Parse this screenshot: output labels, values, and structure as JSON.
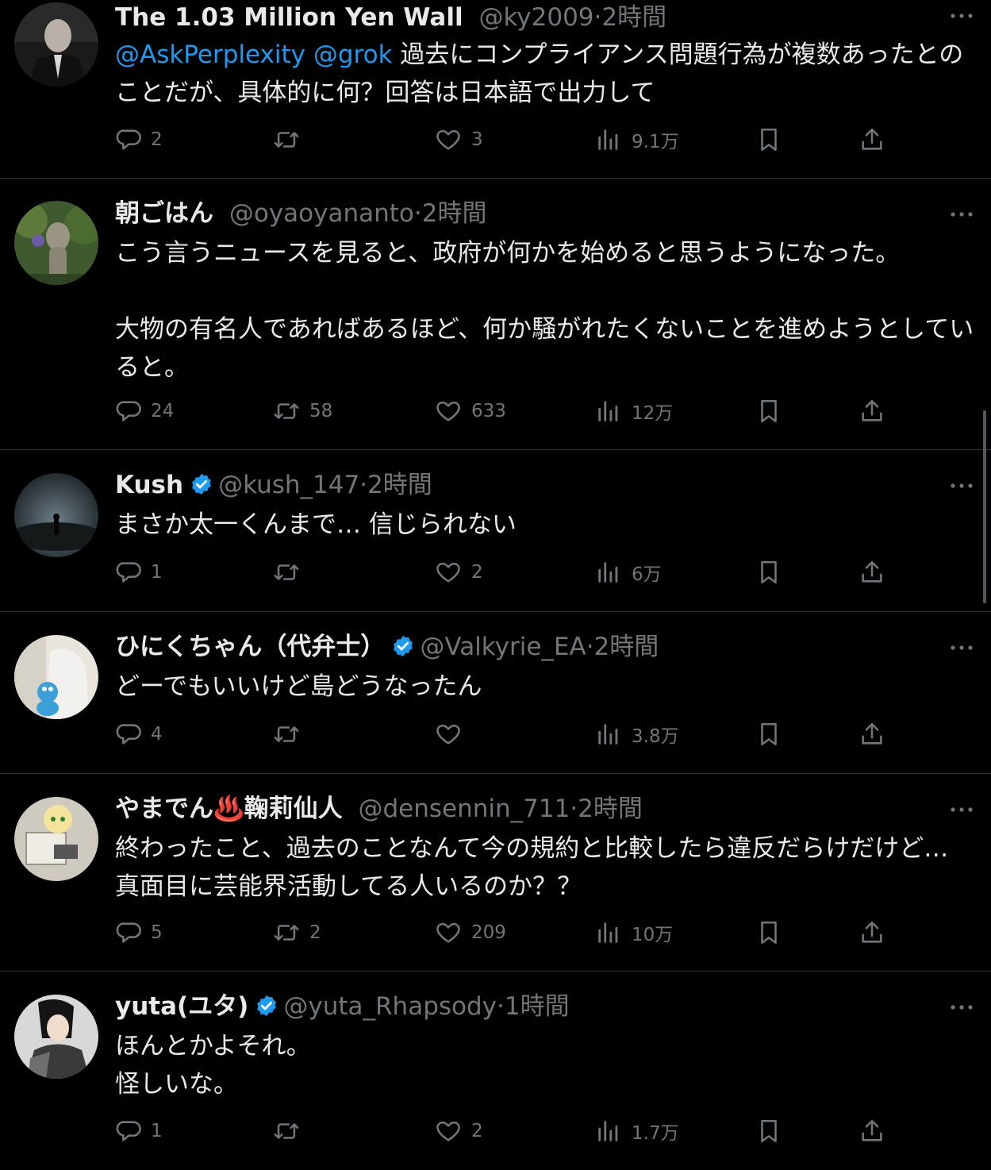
{
  "tweets": [
    {
      "name": "The 1.03 Million Yen Wall",
      "handle": "@ky2009",
      "time": "·2時間",
      "verified": false,
      "avatar": "man-in-suit-photo",
      "mentions": [
        "@AskPerplexity",
        "@grok"
      ],
      "text": "過去にコンプライアンス問題行為が複数あったとのことだが、具体的に何？回答は日本語で出力して",
      "replies": "2",
      "retweets": "",
      "likes": "3",
      "views": "9.1万"
    },
    {
      "name": "朝ごはん",
      "handle": "@oyaoyananto",
      "time": "·2時間",
      "verified": false,
      "avatar": "garden-statue-photo",
      "text": "こう言うニュースを見ると、政府が何かを始めると思うようになった。\n\n大物の有名人であればあるほど、何か騒がれたくないことを進めようとしていると。",
      "replies": "24",
      "retweets": "58",
      "likes": "633",
      "views": "12万"
    },
    {
      "name": "Kush",
      "handle": "@kush_147",
      "time": "·2時間",
      "verified": true,
      "avatar": "dark-landscape-figure",
      "text": "まさか太一くんまで… 信じられない",
      "replies": "1",
      "retweets": "",
      "likes": "2",
      "views": "6万"
    },
    {
      "name": "ひにくちゃん（代弁士）",
      "handle": "@Valkyrie_EA",
      "time": "·2時間",
      "verified": true,
      "avatar": "plush-toy-photo",
      "text": "どーでもいいけど島どうなったん",
      "replies": "4",
      "retweets": "",
      "likes": "",
      "views": "3.8万"
    },
    {
      "name": "やまでん♨️鞠莉仙人",
      "handle": "@densennin_711",
      "time": "·2時間",
      "verified": false,
      "avatar": "anime-character-illustration",
      "text": "終わったこと、過去のことなんて今の規約と比較したら違反だらけだけど…\n真面目に芸能界活動してる人いるのか？？",
      "replies": "5",
      "retweets": "2",
      "likes": "209",
      "views": "10万"
    },
    {
      "name": "yuta(ユタ)",
      "handle": "@yuta_Rhapsody",
      "time": "·1時間",
      "verified": true,
      "avatar": "cosplay-character-photo",
      "text": "ほんとかよそれ。\n怪しいな。",
      "replies": "1",
      "retweets": "",
      "likes": "2",
      "views": "1.7万"
    }
  ],
  "icons": {
    "reply": "reply-icon",
    "retweet": "retweet-icon",
    "like": "heart-icon",
    "views": "views-chart-icon",
    "bookmark": "bookmark-icon",
    "share": "share-icon",
    "more": "more-dots-icon",
    "verified": "verified-badge-icon"
  },
  "colors": {
    "background": "#000000",
    "text": "#e7e9ea",
    "muted": "#71767b",
    "link": "#1d9bf0",
    "divider": "#2f3336"
  }
}
